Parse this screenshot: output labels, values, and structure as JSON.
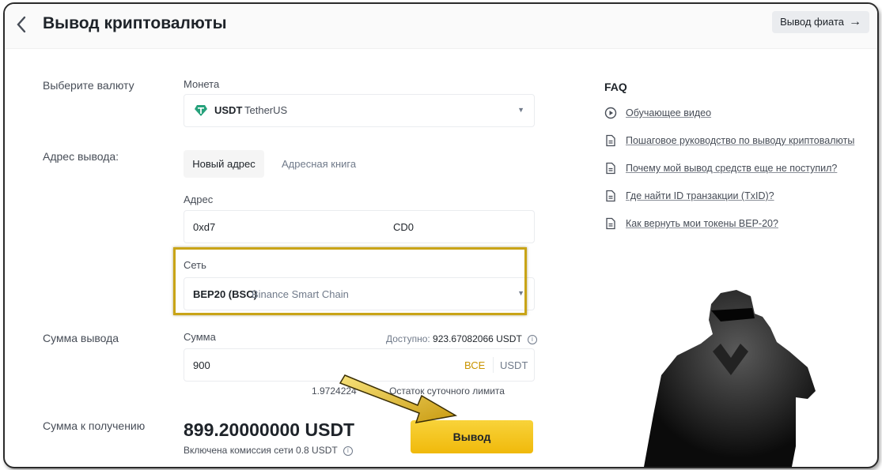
{
  "header": {
    "title": "Вывод криптовалюты",
    "fiat_button": "Вывод фиата",
    "back_icon": "chevron-left-icon"
  },
  "coin_section": {
    "label": "Выберите валюту",
    "field_label": "Монета",
    "coin_code": "USDT",
    "coin_name": "TetherUS",
    "coin_icon": "tether-icon",
    "coin_color": "#26a17b"
  },
  "address_section": {
    "label": "Адрес вывода:",
    "tab_new": "Новый адрес",
    "tab_book": "Адресная книга",
    "field_label": "Адрес",
    "address_start": "0xd7",
    "address_end": "CD0"
  },
  "network": {
    "field_label": "Сеть",
    "code": "BEP20 (BSC)",
    "name": "Binance Smart Chain",
    "highlight_color": "#c9a417"
  },
  "amount_section": {
    "label": "Сумма вывода",
    "field_label": "Сумма",
    "available_label": "Доступно:",
    "available_value": "923.67082066 USDT",
    "value": "900",
    "all_button": "ВСЕ",
    "unit": "USDT",
    "limit_value": "1.9724224",
    "limit_label": "Остаток суточного лимита"
  },
  "receive_section": {
    "label": "Сумма к получению",
    "amount": "899.20000000 USDT",
    "fee_text": "Включена комиссия сети 0.8 USDT"
  },
  "withdraw_button": "Вывод",
  "accent_color": "#f0b90b",
  "faq": {
    "title": "FAQ",
    "items": [
      {
        "icon": "play-circle-icon",
        "label": "Обучающее видео"
      },
      {
        "icon": "document-icon",
        "label": "Пошаговое руководство по выводу криптовалюты"
      },
      {
        "icon": "document-icon",
        "label": "Почему мой вывод средств еще не поступил?"
      },
      {
        "icon": "document-icon",
        "label": "Где найти ID транзакции (TxID)?"
      },
      {
        "icon": "document-icon",
        "label": "Как вернуть мои токены BEP-20?"
      }
    ]
  }
}
